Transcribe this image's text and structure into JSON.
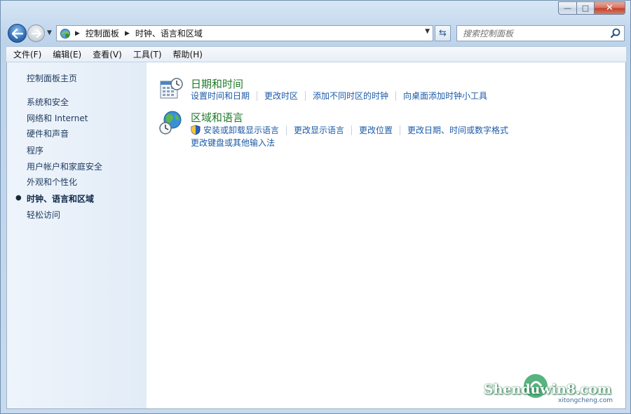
{
  "window": {
    "minimize": "—",
    "maximize": "□",
    "close": "✕"
  },
  "address": {
    "crumbs": [
      "控制面板",
      "时钟、语言和区域"
    ]
  },
  "search": {
    "placeholder": "搜索控制面板"
  },
  "menu": [
    "文件(F)",
    "编辑(E)",
    "查看(V)",
    "工具(T)",
    "帮助(H)"
  ],
  "sidebar": {
    "items": [
      {
        "label": "控制面板主页"
      },
      {
        "label": "系统和安全"
      },
      {
        "label": "网络和 Internet"
      },
      {
        "label": "硬件和声音"
      },
      {
        "label": "程序"
      },
      {
        "label": "用户帐户和家庭安全"
      },
      {
        "label": "外观和个性化"
      },
      {
        "label": "时钟、语言和区域"
      },
      {
        "label": "轻松访问"
      }
    ],
    "active_index": 7
  },
  "categories": [
    {
      "title": "日期和时间",
      "icon": "calendar-clock-icon",
      "tasks": [
        "设置时间和日期",
        "更改时区",
        "添加不同时区的时钟",
        "向桌面添加时钟小工具"
      ]
    },
    {
      "title": "区域和语言",
      "icon": "globe-clock-icon",
      "tasks": [
        "安装或卸载显示语言",
        "更改显示语言",
        "更改位置",
        "更改日期、时间或数字格式"
      ],
      "tasks2": [
        "更改键盘或其他输入法"
      ]
    }
  ],
  "watermark": {
    "text": "Shenduwin8.com",
    "sub": "xitongcheng.com"
  }
}
